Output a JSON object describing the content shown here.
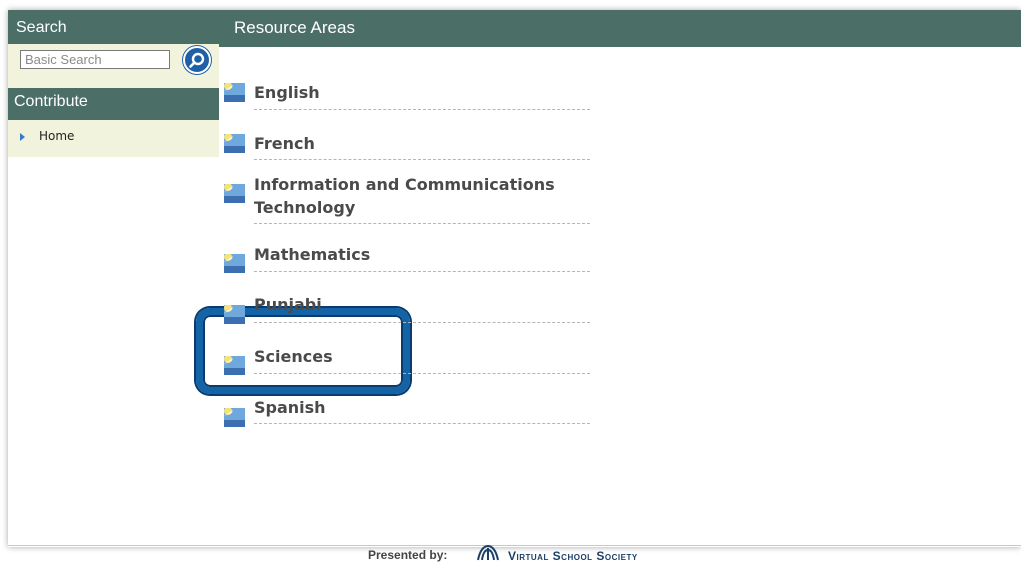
{
  "sidebar": {
    "search_title": "Search",
    "search_placeholder": "Basic Search",
    "search_button_icon": "search-icon",
    "contribute_title": "Contribute",
    "nav": [
      {
        "label": "Home",
        "icon": "triangle-right-icon"
      }
    ]
  },
  "main": {
    "title": "Resource Areas",
    "areas": [
      {
        "label": "English"
      },
      {
        "label": "French"
      },
      {
        "label": "Information and Communications Technology"
      },
      {
        "label": "Mathematics"
      },
      {
        "label": "Punjabi"
      },
      {
        "label": "Sciences",
        "highlighted": true
      },
      {
        "label": "Spanish"
      }
    ],
    "item_icon": "sunrise-icon"
  },
  "footer": {
    "presented_by": "Presented by:",
    "organization": "Virtual School Society",
    "logo_icon": "vs-logo-icon"
  },
  "colors": {
    "header": "#4b6f66",
    "sidebar_bg": "#f1f3dd",
    "accent": "#1f5fa8",
    "highlight": "#1463a6"
  }
}
